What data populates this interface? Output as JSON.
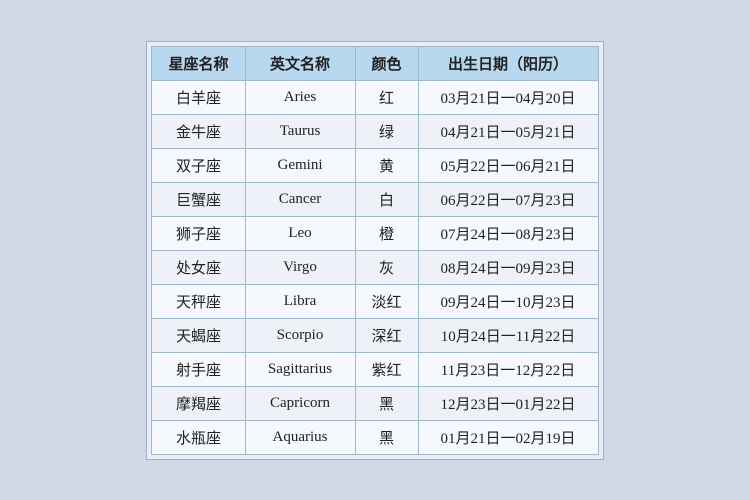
{
  "table": {
    "headers": {
      "chinese_name": "星座名称",
      "english_name": "英文名称",
      "color": "颜色",
      "date_range": "出生日期（阳历）"
    },
    "rows": [
      {
        "chinese": "白羊座",
        "english": "Aries",
        "color": "红",
        "date": "03月21日一04月20日"
      },
      {
        "chinese": "金牛座",
        "english": "Taurus",
        "color": "绿",
        "date": "04月21日一05月21日"
      },
      {
        "chinese": "双子座",
        "english": "Gemini",
        "color": "黄",
        "date": "05月22日一06月21日"
      },
      {
        "chinese": "巨蟹座",
        "english": "Cancer",
        "color": "白",
        "date": "06月22日一07月23日"
      },
      {
        "chinese": "狮子座",
        "english": "Leo",
        "color": "橙",
        "date": "07月24日一08月23日"
      },
      {
        "chinese": "处女座",
        "english": "Virgo",
        "color": "灰",
        "date": "08月24日一09月23日"
      },
      {
        "chinese": "天秤座",
        "english": "Libra",
        "color": "淡红",
        "date": "09月24日一10月23日"
      },
      {
        "chinese": "天蝎座",
        "english": "Scorpio",
        "color": "深红",
        "date": "10月24日一11月22日"
      },
      {
        "chinese": "射手座",
        "english": "Sagittarius",
        "color": "紫红",
        "date": "11月23日一12月22日"
      },
      {
        "chinese": "摩羯座",
        "english": "Capricorn",
        "color": "黑",
        "date": "12月23日一01月22日"
      },
      {
        "chinese": "水瓶座",
        "english": "Aquarius",
        "color": "黑",
        "date": "01月21日一02月19日"
      }
    ]
  }
}
